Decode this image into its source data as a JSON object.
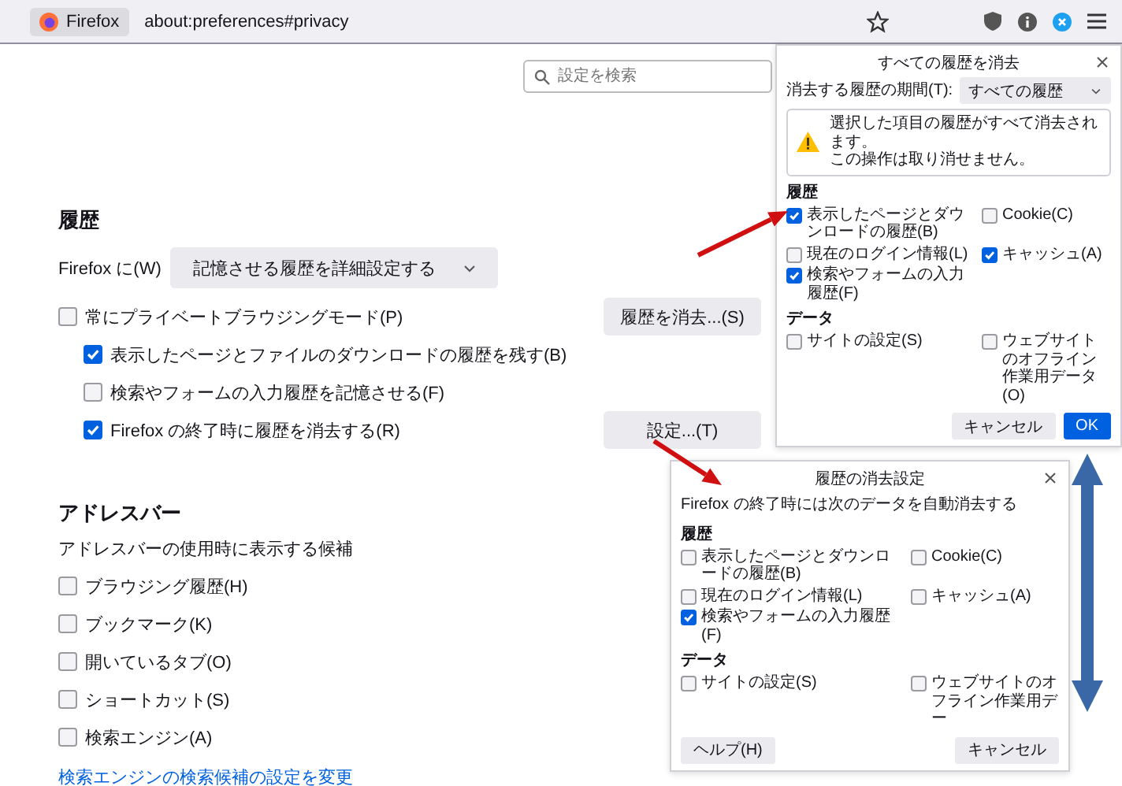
{
  "toolbar": {
    "identity_label": "Firefox",
    "url": "about:preferences#privacy"
  },
  "search": {
    "placeholder": "設定を検索"
  },
  "history": {
    "heading": "履歴",
    "mode_label": "Firefox に(W)",
    "mode_value": "記憶させる履歴を詳細設定する",
    "options": [
      {
        "label": "常にプライベートブラウジングモード(P)",
        "checked": false,
        "button": "履歴を消去...(S)",
        "children": [
          {
            "label": "表示したページとファイルのダウンロードの履歴を残す(B)",
            "checked": true
          },
          {
            "label": "検索やフォームの入力履歴を記憶させる(F)",
            "checked": false
          },
          {
            "label": "Firefox の終了時に履歴を消去する(R)",
            "checked": true,
            "button": "設定...(T)"
          }
        ]
      }
    ]
  },
  "address_bar": {
    "heading": "アドレスバー",
    "description": "アドレスバーの使用時に表示する候補",
    "options": [
      {
        "label": "ブラウジング履歴(H)",
        "checked": false
      },
      {
        "label": "ブックマーク(K)",
        "checked": false
      },
      {
        "label": "開いているタブ(O)",
        "checked": false
      },
      {
        "label": "ショートカット(S)",
        "checked": false
      },
      {
        "label": "検索エンジン(A)",
        "checked": false
      }
    ],
    "link": "検索エンジンの検索候補の設定を変更"
  },
  "clear_dialog": {
    "title": "すべての履歴を消去",
    "range_label": "消去する履歴の期間(T):",
    "range_value": "すべての履歴",
    "warning": [
      "選択した項目の履歴がすべて消去されます。",
      "この操作は取り消せません。"
    ],
    "sections": [
      {
        "heading": "履歴",
        "options": [
          {
            "label": "表示したページとダウンロードの履歴(B)",
            "checked": true
          },
          {
            "label": "Cookie(C)",
            "checked": false
          },
          {
            "label": "現在のログイン情報(L)",
            "checked": false
          },
          {
            "label": "キャッシュ(A)",
            "checked": true
          },
          {
            "label": "検索やフォームの入力履歴(F)",
            "checked": true
          }
        ]
      },
      {
        "heading": "データ",
        "options": [
          {
            "label": "サイトの設定(S)",
            "checked": false
          },
          {
            "label": "ウェブサイトのオフライン作業用データ(O)",
            "checked": false
          }
        ]
      }
    ],
    "buttons": [
      {
        "label": "キャンセル",
        "primary": false
      },
      {
        "label": "OK",
        "primary": true
      }
    ]
  },
  "settings_dialog": {
    "title": "履歴の消去設定",
    "description": "Firefox の終了時には次のデータを自動消去する",
    "sections": [
      {
        "heading": "履歴",
        "options": [
          {
            "label": "表示したページとダウンロードの履歴(B)",
            "checked": false
          },
          {
            "label": "Cookie(C)",
            "checked": false
          },
          {
            "label": "現在のログイン情報(L)",
            "checked": false
          },
          {
            "label": "キャッシュ(A)",
            "checked": false
          },
          {
            "label": "検索やフォームの入力履歴(F)",
            "checked": true
          }
        ]
      },
      {
        "heading": "データ",
        "options": [
          {
            "label": "サイトの設定(S)",
            "checked": false
          },
          {
            "label": "ウェブサイトのオフライン作業用デー",
            "checked": false
          }
        ]
      }
    ],
    "help_button": "ヘルプ(H)",
    "buttons": [
      {
        "label": "キャンセル",
        "primary": false
      }
    ]
  }
}
